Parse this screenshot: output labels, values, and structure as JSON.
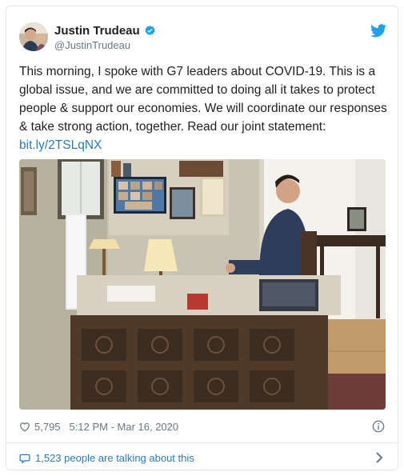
{
  "tweet": {
    "author_name": "Justin Trudeau",
    "author_handle": "@JustinTrudeau",
    "text": "This morning, I spoke with G7 leaders about COVID-19. This is a global issue, and we are committed to doing all it takes to protect people & support our economies. We will coordinate our responses & take strong action, together. Read our joint statement: ",
    "link_text": "bit.ly/2TSLqNX",
    "likes": "5,795",
    "timestamp": "5:12 PM - Mar 16, 2020",
    "talking_text": "1,523 people are talking about this"
  },
  "icons": {
    "verified": "verified-badge-icon",
    "brand": "twitter-bird-icon",
    "like": "heart-icon",
    "info": "info-icon",
    "comments": "speech-bubble-icon",
    "more": "chevron-right-icon"
  },
  "colors": {
    "link": "#2b7bb9",
    "twitter_blue": "#1da1f2",
    "text": "#1c2022",
    "muted": "#697882",
    "border": "#e1e8ed"
  }
}
